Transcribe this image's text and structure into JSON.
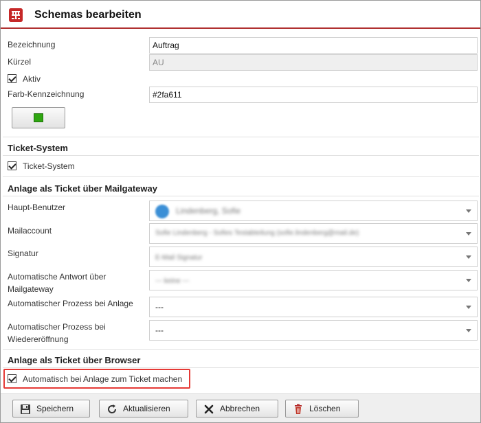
{
  "dialog": {
    "title": "Schemas bearbeiten",
    "app_icon": "grid-logo-icon"
  },
  "form": {
    "bezeichnung_label": "Bezeichnung",
    "bezeichnung_value": "Auftrag",
    "kuerzel_label": "Kürzel",
    "kuerzel_value": "AU",
    "aktiv_label": "Aktiv",
    "aktiv_checked": true,
    "farb_label": "Farb-Kennzeichnung",
    "farb_value": "#2fa611",
    "color_swatch": "#2fa611"
  },
  "ticket_system": {
    "section_title": "Ticket-System",
    "checkbox_label": "Ticket-System",
    "checked": true
  },
  "mailgateway": {
    "section_title": "Anlage als Ticket über Mailgateway",
    "haupt_benutzer_label": "Haupt-Benutzer",
    "haupt_benutzer_value": "Lindenberg, Sofie",
    "mailaccount_label": "Mailaccount",
    "mailaccount_value": "Sofie Lindenberg - Sofies Testabteilung (sofie.lindenberg@mail.de)",
    "signatur_label": "Signatur",
    "signatur_value": "E-Mail Signatur",
    "auto_antwort_label_1": "Automatische Antwort über",
    "auto_antwort_label_2": "Mailgateway",
    "auto_antwort_value": "--- keine ---",
    "auto_prozess_anlage_label": "Automatischer Prozess bei Anlage",
    "auto_prozess_anlage_value": "---",
    "auto_prozess_wieder_label_1": "Automatischer Prozess bei",
    "auto_prozess_wieder_label_2": "Wiedereröffnung",
    "auto_prozess_wieder_value": "---"
  },
  "browser": {
    "section_title": "Anlage als Ticket über Browser",
    "checkbox_label": "Automatisch bei Anlage zum Ticket machen",
    "checked": true
  },
  "footer": {
    "save_label": "Speichern",
    "refresh_label": "Aktualisieren",
    "cancel_label": "Abbrechen",
    "delete_label": "Löschen"
  },
  "colors": {
    "accent_line": "#b03030",
    "highlight": "#e53935"
  }
}
